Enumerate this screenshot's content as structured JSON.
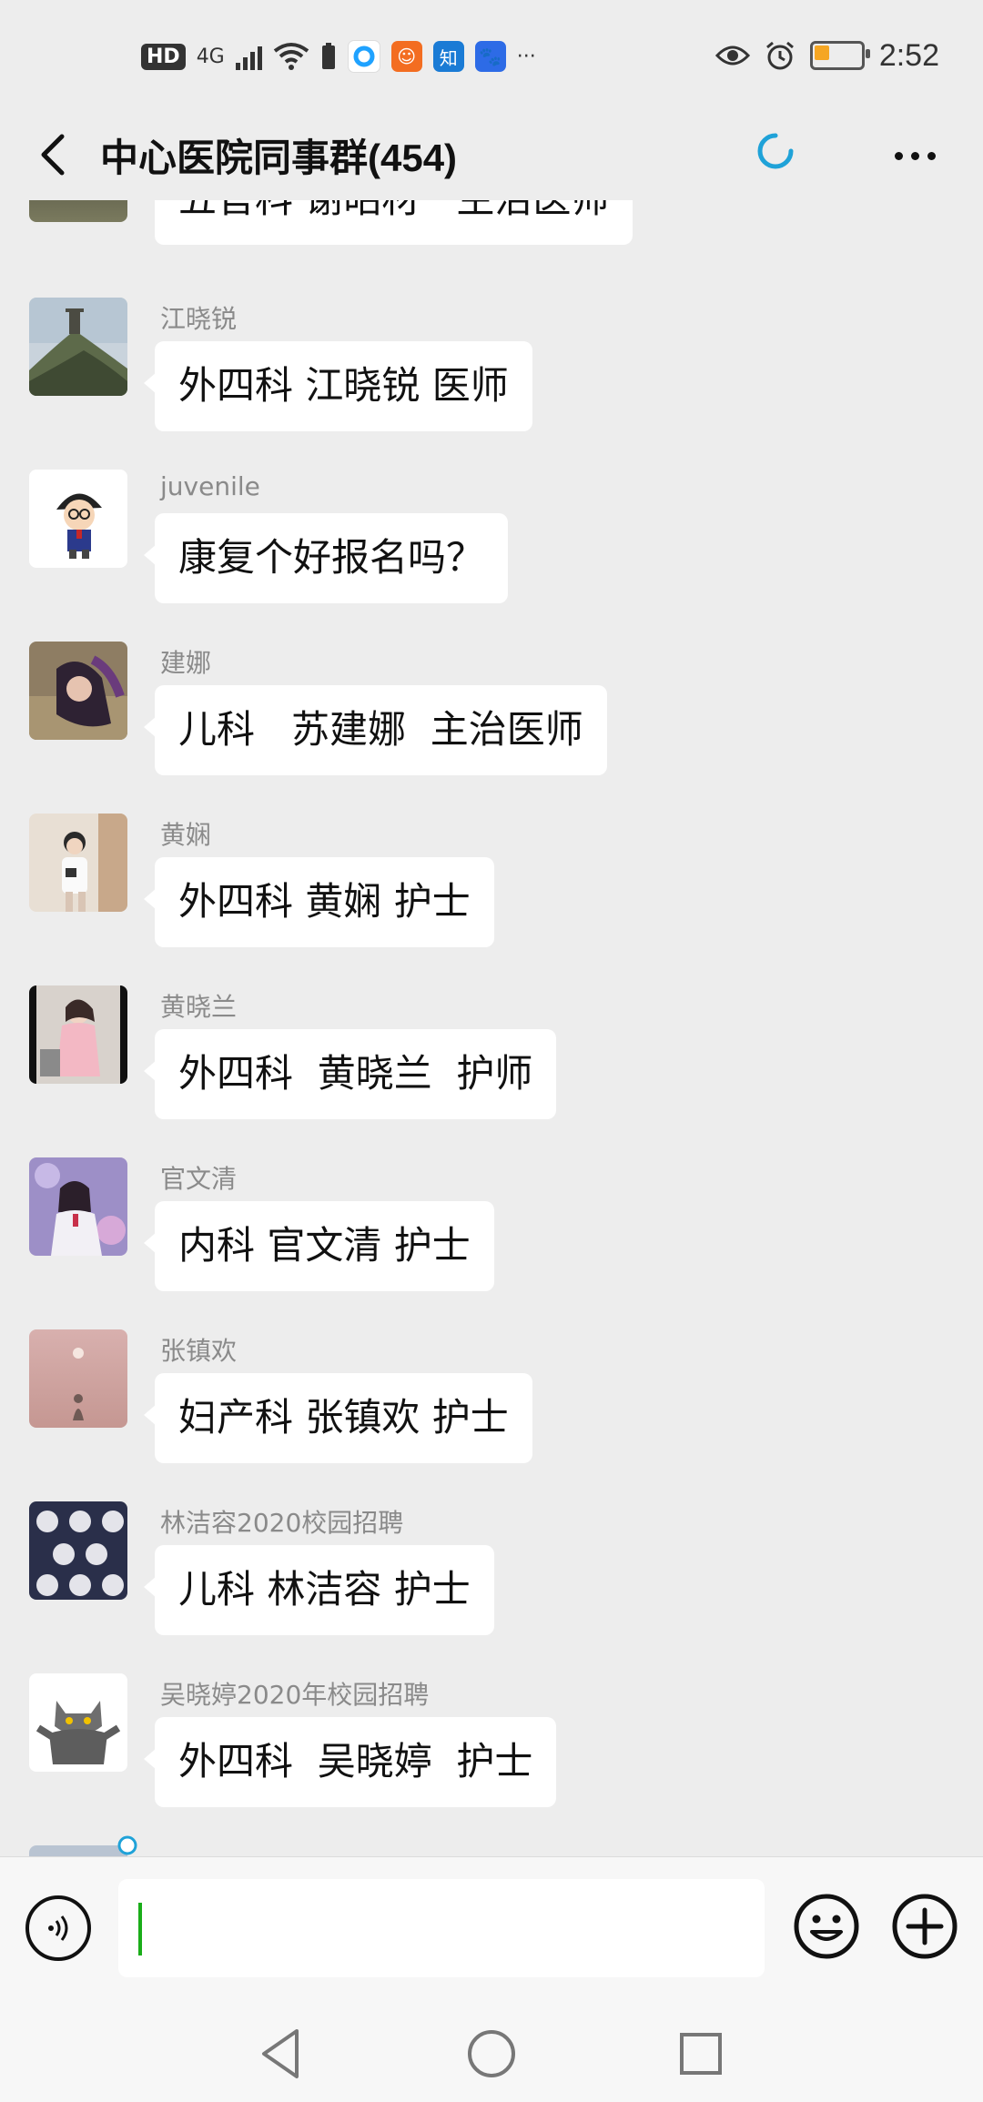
{
  "status_bar": {
    "hd": "HD",
    "signal": "4G",
    "app_zhihu": "知",
    "more": "···",
    "time": "2:52",
    "battery_level": 0.3,
    "colors": {
      "battery": "#f5a623",
      "uc": "#f36d21",
      "zhihu": "#1a7bd5",
      "baidu": "#2d6be6",
      "browser": "#1fa2ff"
    }
  },
  "header": {
    "title": "中心医院同事群(454)"
  },
  "messages": [
    {
      "sender": "",
      "text": "五官科 谢昭材   主治医师",
      "avatar": "landscape-dark"
    },
    {
      "sender": "江晓锐",
      "text": "外四科 江晓锐 医师",
      "avatar": "mountain-tower"
    },
    {
      "sender": "juvenile",
      "text": "康复个好报名吗？",
      "avatar": "cartoon-detective"
    },
    {
      "sender": "建娜",
      "text": "儿科   苏建娜  主治医师",
      "avatar": "portrait-purple"
    },
    {
      "sender": "黄娴",
      "text": "外四科 黄娴 护士",
      "avatar": "portrait-white-shirt"
    },
    {
      "sender": "黄晓兰",
      "text": "外四科  黄晓兰  护师",
      "avatar": "portrait-dress"
    },
    {
      "sender": "官文清",
      "text": "内科 官文清 护士",
      "avatar": "portrait-purple-flowers"
    },
    {
      "sender": "张镇欢",
      "text": "妇产科 张镇欢 护士",
      "avatar": "pink-sunset"
    },
    {
      "sender": "林洁容2020校园招聘",
      "text": "儿科 林洁容 护士",
      "avatar": "pattern-tile"
    },
    {
      "sender": "吴晓婷2020年校园招聘",
      "text": "外四科  吴晓婷  护士",
      "avatar": "cartoon-cat"
    }
  ],
  "input_bar": {
    "value": "",
    "placeholder": "",
    "voice_icon": "voice-icon",
    "emoji_icon": "emoji-icon",
    "plus_icon": "plus-icon",
    "caret_color": "#1aad19"
  },
  "nav_bar": {
    "icons": [
      "back-triangle-icon",
      "home-circle-icon",
      "recents-square-icon"
    ]
  }
}
